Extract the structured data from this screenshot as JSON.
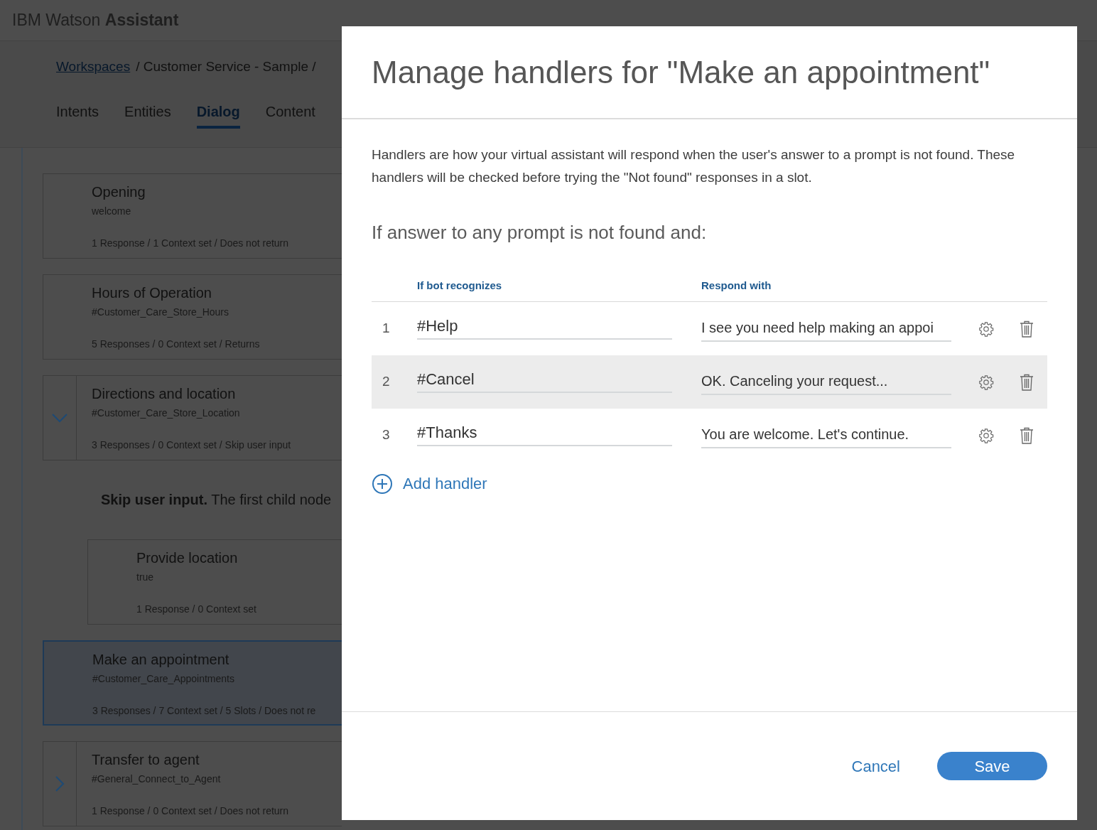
{
  "app": {
    "title_plain": "IBM Watson",
    "title_bold": "Assistant"
  },
  "breadcrumb": {
    "link": "Workspaces",
    "rest": "/ Customer Service - Sample /"
  },
  "tabs": [
    {
      "label": "Intents",
      "selected": false
    },
    {
      "label": "Entities",
      "selected": false
    },
    {
      "label": "Dialog",
      "selected": true
    },
    {
      "label": "Content",
      "selected": false
    }
  ],
  "nodes": [
    {
      "name": "Opening",
      "condition": "welcome",
      "summary": "1 Response / 1 Context set / Does not return",
      "child": false,
      "selected": false
    },
    {
      "name": "Hours of Operation",
      "condition": "#Customer_Care_Store_Hours",
      "summary": "5 Responses / 0 Context set / Returns",
      "child": false,
      "selected": false
    },
    {
      "name": "Directions and location",
      "condition": "#Customer_Care_Store_Location",
      "summary": "3 Responses / 0 Context set / Skip user input",
      "expanded": true,
      "child": false,
      "selected": false
    },
    {
      "kind": "note",
      "text": "**Skip user input.** The first child node"
    },
    {
      "name": "Provide location",
      "condition": "true",
      "summary": "1 Response / 0 Context set",
      "child": true,
      "selected": false
    },
    {
      "name": "Make an appointment",
      "condition": "#Customer_Care_Appointments",
      "summary": "3 Responses / 7 Context set / 5 Slots / Does not re",
      "child": false,
      "selected": true
    },
    {
      "name": "Transfer to agent",
      "condition": "#General_Connect_to_Agent",
      "summary": "1 Response / 0 Context set / Does not return",
      "expanded": false,
      "child": false,
      "selected": false
    }
  ],
  "modal": {
    "title": "Manage handlers for \"Make an appointment\"",
    "description": "Handlers are how your virtual assistant will respond when the user's answer to a prompt is not found. These handlers will be checked before trying the \"Not found\" responses in a slot.",
    "subheading": "If answer to any prompt is not found and:",
    "columns": [
      "If bot recognizes",
      "Respond with"
    ],
    "handlers": [
      {
        "number": "1",
        "intent": "#Help",
        "response": "I see you need help making an appoi",
        "selected": false
      },
      {
        "number": "2",
        "intent": "#Cancel",
        "response": "OK. Canceling your request...",
        "selected": true
      },
      {
        "number": "3",
        "intent": "#Thanks",
        "response": "You are welcome. Let's continue.",
        "selected": false
      }
    ],
    "add_label": "Add handler",
    "cancel": "Cancel",
    "save": "Save"
  }
}
